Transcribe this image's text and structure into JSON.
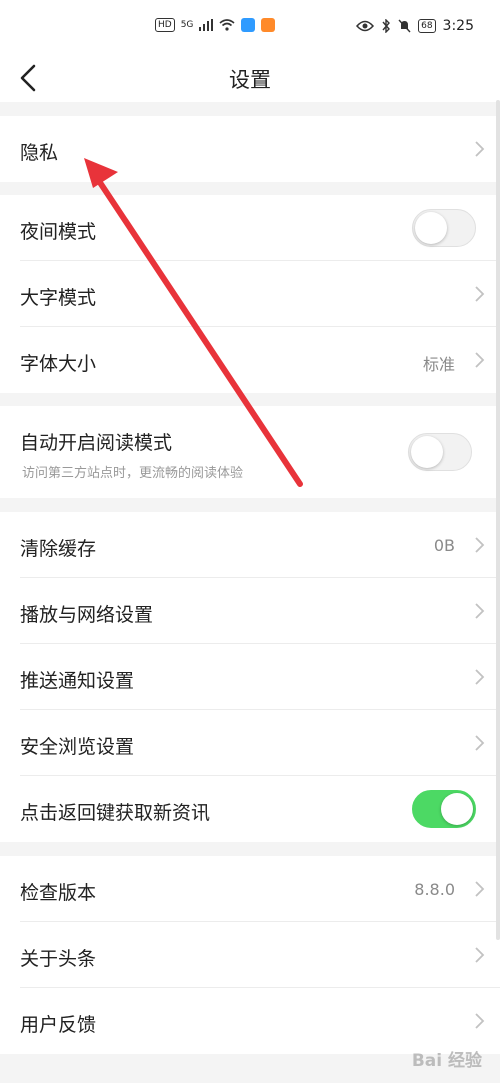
{
  "status_bar": {
    "hd": "HD",
    "network": "5G",
    "battery": "68",
    "time": "3:25"
  },
  "nav": {
    "title": "设置"
  },
  "rows": {
    "privacy": {
      "label": "隐私"
    },
    "night_mode": {
      "label": "夜间模式",
      "toggle_on": false
    },
    "large_text": {
      "label": "大字模式"
    },
    "font_size": {
      "label": "字体大小",
      "value": "标准"
    },
    "reading_mode": {
      "label": "自动开启阅读模式",
      "sub": "访问第三方站点时，更流畅的阅读体验",
      "toggle_on": false
    },
    "clear_cache": {
      "label": "清除缓存",
      "value": "0B"
    },
    "playback_network": {
      "label": "播放与网络设置"
    },
    "push_notify": {
      "label": "推送通知设置"
    },
    "safe_browsing": {
      "label": "安全浏览设置"
    },
    "back_refresh": {
      "label": "点击返回键获取新资讯",
      "toggle_on": true
    },
    "check_version": {
      "label": "检查版本",
      "value": "8.8.0"
    },
    "about": {
      "label": "关于头条"
    },
    "feedback": {
      "label": "用户反馈"
    }
  },
  "watermark": {
    "text": "Bai 经验"
  },
  "colors": {
    "toggle_on": "#4cd964",
    "annotation_arrow": "#e8333a"
  },
  "icons": {
    "back": "chevron-left-icon",
    "row_chevron": "chevron-right-icon"
  }
}
